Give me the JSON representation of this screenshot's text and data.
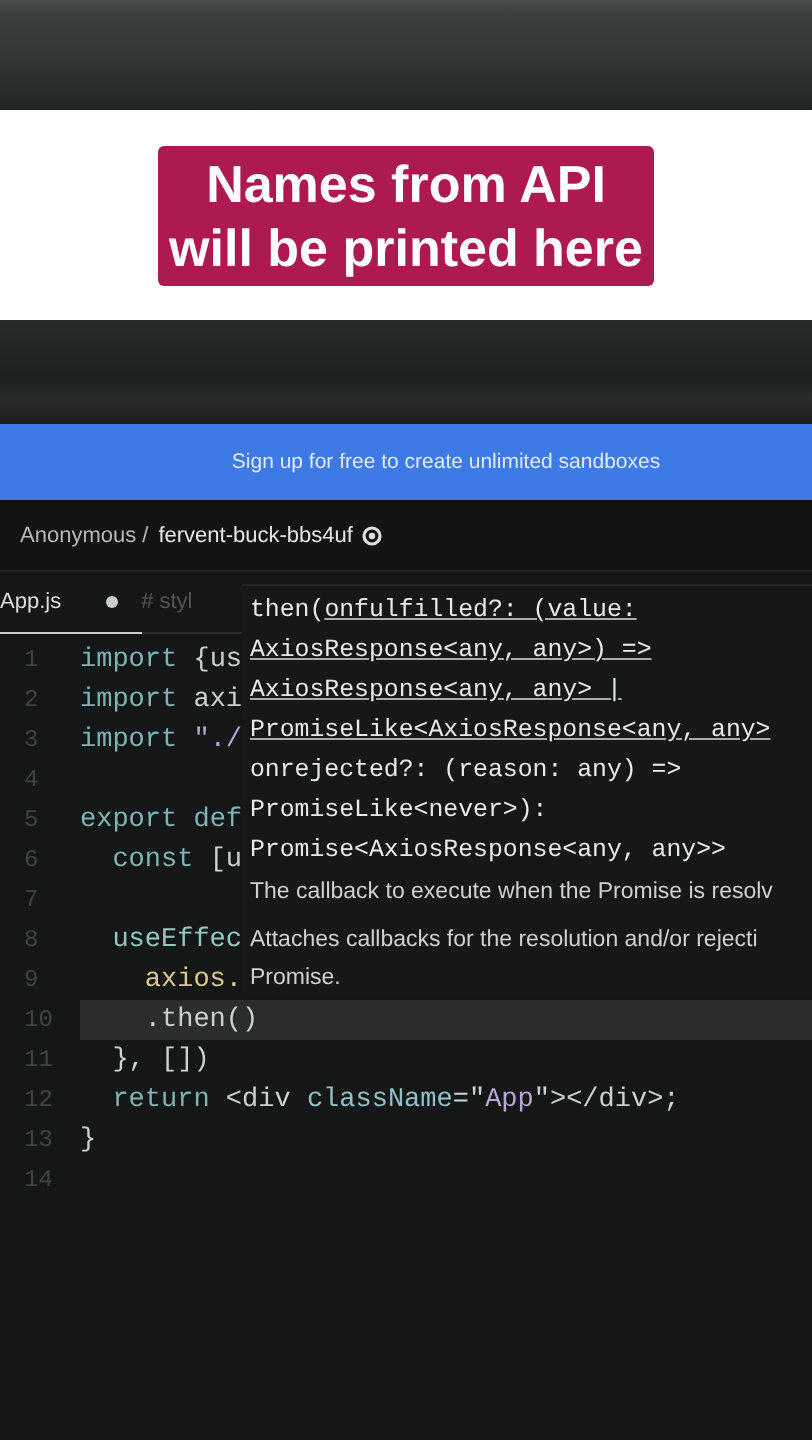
{
  "caption": {
    "lines": [
      "Names from API",
      "will be printed here"
    ]
  },
  "banner": {
    "text": "Sign up for free to create unlimited sandboxes"
  },
  "breadcrumb": {
    "owner": "Anonymous /",
    "sandbox": "fervent-buck-bbs4uf"
  },
  "tabs": [
    {
      "label": "App.js",
      "modified": true,
      "selected": true
    },
    {
      "label": "# styl",
      "modified": false,
      "selected": false
    }
  ],
  "code_lines": [
    {
      "number": "1",
      "selected": false,
      "tokens": [
        {
          "text": "import ",
          "kind": "kw"
        },
        {
          "text": "{us",
          "kind": "plain"
        }
      ]
    },
    {
      "number": "2",
      "selected": false,
      "tokens": [
        {
          "text": "import ",
          "kind": "kw"
        },
        {
          "text": "axi",
          "kind": "plain"
        }
      ]
    },
    {
      "number": "3",
      "selected": false,
      "tokens": [
        {
          "text": "import ",
          "kind": "kw"
        },
        {
          "text": "\"./",
          "kind": "str"
        }
      ]
    },
    {
      "number": "4",
      "selected": false
    },
    {
      "number": "5",
      "selected": false,
      "tokens": [
        {
          "text": "export ",
          "kind": "kw"
        },
        {
          "text": "def",
          "kind": "kw"
        }
      ]
    },
    {
      "number": "6",
      "selected": false,
      "tokens": [
        {
          "text": "  const ",
          "kind": "kw"
        },
        {
          "text": "[u",
          "kind": "plain"
        }
      ]
    },
    {
      "number": "7",
      "selected": false
    },
    {
      "number": "8",
      "selected": false,
      "tokens": [
        {
          "text": "  useEffec",
          "kind": "fn"
        }
      ]
    },
    {
      "number": "9",
      "selected": false,
      "tokens": [
        {
          "text": "    axios.",
          "kind": "var"
        }
      ]
    },
    {
      "number": "10",
      "selected": true,
      "tokens": [
        {
          "text": "    .then()",
          "kind": "plain"
        }
      ]
    },
    {
      "number": "11",
      "selected": false,
      "tokens": [
        {
          "text": "  }, [])",
          "kind": "plain"
        }
      ]
    },
    {
      "number": "12",
      "selected": false,
      "tokens": [
        {
          "text": "  return ",
          "kind": "kw"
        },
        {
          "text": "<div ",
          "kind": "plain"
        },
        {
          "text": "className",
          "kind": "attr"
        },
        {
          "text": "=\"",
          "kind": "plain"
        },
        {
          "text": "App",
          "kind": "str"
        },
        {
          "text": "\"></div>;",
          "kind": "plain"
        }
      ]
    },
    {
      "number": "13",
      "selected": false,
      "tokens": [
        {
          "text": "}",
          "kind": "plain"
        }
      ]
    },
    {
      "number": "14",
      "selected": false
    }
  ],
  "tooltip": {
    "signature": [
      {
        "plain": "then(",
        "underlined": "onfulfilled?: (value:"
      },
      {
        "underlined": "AxiosResponse<any, any>) =>"
      },
      {
        "underlined": "AxiosResponse<any, any> |"
      },
      {
        "underlined": "PromiseLike<AxiosResponse<any, any>"
      },
      {
        "plain": "onrejected?: (reason: any) =>"
      },
      {
        "plain": "PromiseLike<never>):"
      },
      {
        "plain": "Promise<AxiosResponse<any, any>>"
      }
    ],
    "docs": [
      "The callback to execute when the Promise is resolv",
      "Attaches callbacks for the resolution and/or rejecti",
      "Promise."
    ]
  }
}
